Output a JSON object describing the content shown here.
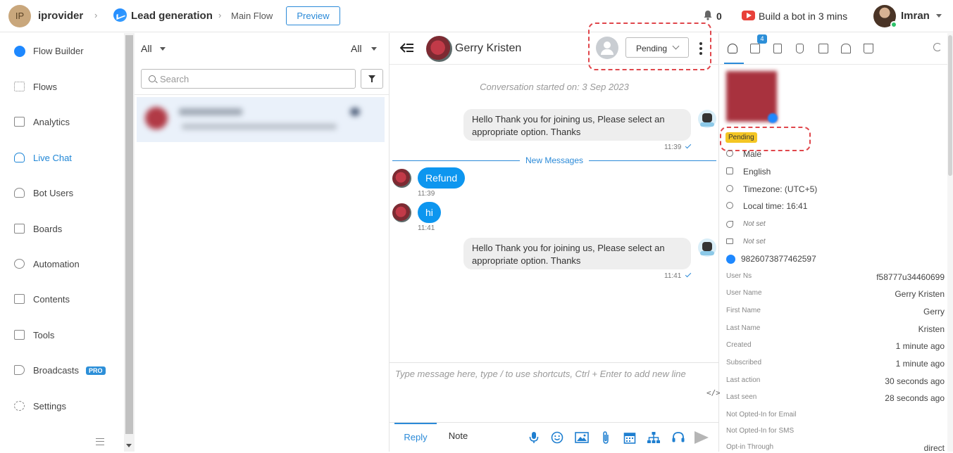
{
  "topbar": {
    "avatar_initials": "IP",
    "workspace": "iprovider",
    "breadcrumb_bot": "Lead generation",
    "breadcrumb_flow": "Main Flow",
    "preview_label": "Preview",
    "notification_count": "0",
    "build_bot_label": "Build a bot in 3 mins",
    "user_name": "Imran"
  },
  "sidebar": {
    "items": [
      {
        "label": "Flow Builder",
        "icon": "messenger-icon"
      },
      {
        "label": "Flows",
        "icon": "grid-icon"
      },
      {
        "label": "Analytics",
        "icon": "chart-icon"
      },
      {
        "label": "Live Chat",
        "icon": "headset-icon"
      },
      {
        "label": "Bot Users",
        "icon": "user-icon"
      },
      {
        "label": "Boards",
        "icon": "board-icon"
      },
      {
        "label": "Automation",
        "icon": "automation-icon"
      },
      {
        "label": "Contents",
        "icon": "contents-icon"
      },
      {
        "label": "Tools",
        "icon": "tools-icon"
      },
      {
        "label": "Broadcasts",
        "icon": "megaphone-icon",
        "badge": "PRO"
      },
      {
        "label": "Settings",
        "icon": "gear-icon"
      }
    ],
    "active": "Live Chat"
  },
  "conversation_list": {
    "filter_left": "All",
    "filter_right": "All",
    "search_placeholder": "Search"
  },
  "chat": {
    "contact_name": "Gerry Kristen",
    "status_value": "Pending",
    "conversation_started": "Conversation started on: 3 Sep 2023",
    "new_messages_label": "New Messages",
    "messages": [
      {
        "from": "bot",
        "text": "Hello Thank you for joining us, Please select an appropriate option. Thanks",
        "time": "11:39"
      },
      {
        "from": "user",
        "text": "Refund",
        "time": "11:39"
      },
      {
        "from": "user",
        "text": "hi",
        "time": "11:41"
      },
      {
        "from": "bot",
        "text": "Hello Thank you for joining us, Please select an appropriate option. Thanks",
        "time": "11:41"
      }
    ],
    "composer_placeholder": "Type message here, type / to use shortcuts, Ctrl + Enter to add new line",
    "code_toggle": "</>",
    "tab_reply": "Reply",
    "tab_note": "Note"
  },
  "profile": {
    "tab_badge": "4",
    "status_badge": "Pending",
    "gender": "Male",
    "language": "English",
    "timezone": "Timezone: (UTC+5)",
    "local_time": "Local time: 16:41",
    "phone": "Not set",
    "email": "Not set",
    "messenger_id": "9826073877462597",
    "attributes": [
      {
        "label": "User Ns",
        "value": "f58777u34460699"
      },
      {
        "label": "User Name",
        "value": "Gerry Kristen"
      },
      {
        "label": "First Name",
        "value": "Gerry"
      },
      {
        "label": "Last Name",
        "value": "Kristen"
      },
      {
        "label": "Created",
        "value": "1 minute ago"
      },
      {
        "label": "Subscribed",
        "value": "1 minute ago"
      },
      {
        "label": "Last action",
        "value": "30 seconds ago"
      },
      {
        "label": "Last seen",
        "value": "28 seconds ago"
      },
      {
        "label": "Not Opted-In for Email",
        "value": ""
      },
      {
        "label": "Not Opted-In for SMS",
        "value": ""
      },
      {
        "label": "Opt-in Through",
        "value": "direct"
      }
    ]
  },
  "colors": {
    "accent": "#2b8ad8",
    "user_bubble": "#0d96ef",
    "highlight": "#e0474c",
    "pending": "#f4c623"
  }
}
